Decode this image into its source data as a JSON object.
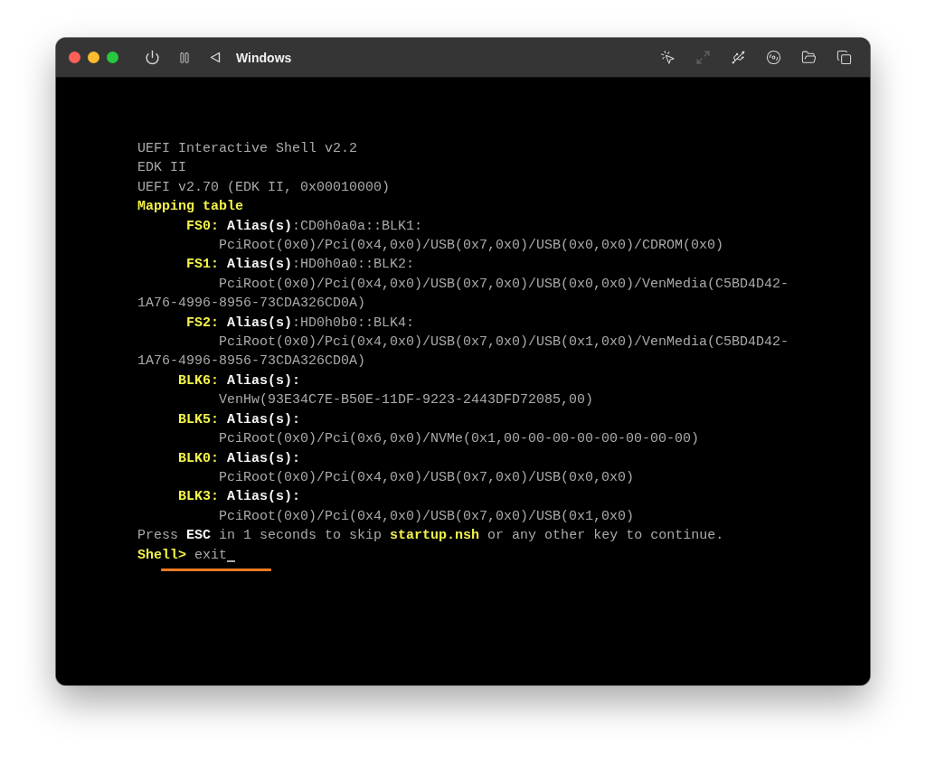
{
  "window": {
    "title": "Windows",
    "toolbar_right": [
      {
        "kind": "pointer",
        "disabled": false
      },
      {
        "kind": "resize",
        "disabled": true
      },
      {
        "kind": "usb",
        "disabled": false
      },
      {
        "kind": "disc",
        "disabled": false
      },
      {
        "kind": "folder",
        "disabled": false
      },
      {
        "kind": "windows",
        "disabled": false
      }
    ]
  },
  "terminal": {
    "lines": [
      {
        "kind": "plain",
        "segments": [
          {
            "color": "#a9a9a9",
            "bold": false,
            "text": "UEFI Interactive Shell v2.2"
          }
        ]
      },
      {
        "kind": "plain",
        "segments": [
          {
            "color": "#a9a9a9",
            "bold": false,
            "text": "EDK II"
          }
        ]
      },
      {
        "kind": "plain",
        "segments": [
          {
            "color": "#a9a9a9",
            "bold": false,
            "text": "UEFI v2.70 (EDK II, 0x00010000)"
          }
        ]
      },
      {
        "kind": "plain",
        "segments": [
          {
            "color": "#f2f24a",
            "bold": true,
            "text": "Mapping table"
          }
        ]
      },
      {
        "kind": "fs",
        "segments": [
          {
            "color": "#f2f24a",
            "bold": true,
            "text": "FS0:"
          },
          {
            "color": "#f4f4f4",
            "bold": true,
            "text": " Alias(s)"
          },
          {
            "color": "#a9a9a9",
            "bold": false,
            "text": ":CD0h0a0a::BLK1:"
          }
        ]
      },
      {
        "kind": "path",
        "segments": [
          {
            "color": "#a9a9a9",
            "bold": false,
            "text": "PciRoot(0x0)/Pci(0x4,0x0)/USB(0x7,0x0)/USB(0x0,0x0)/CDROM(0x0)"
          }
        ]
      },
      {
        "kind": "fs",
        "segments": [
          {
            "color": "#f2f24a",
            "bold": true,
            "text": "FS1:"
          },
          {
            "color": "#f4f4f4",
            "bold": true,
            "text": " Alias(s)"
          },
          {
            "color": "#a9a9a9",
            "bold": false,
            "text": ":HD0h0a0::BLK2:"
          }
        ]
      },
      {
        "kind": "path",
        "segments": [
          {
            "color": "#a9a9a9",
            "bold": false,
            "text": "PciRoot(0x0)/Pci(0x4,0x0)/USB(0x7,0x0)/USB(0x0,0x0)/VenMedia(C5BD4D42-"
          }
        ]
      },
      {
        "kind": "plain",
        "segments": [
          {
            "color": "#a9a9a9",
            "bold": false,
            "text": "1A76-4996-8956-73CDA326CD0A)"
          }
        ]
      },
      {
        "kind": "fs",
        "segments": [
          {
            "color": "#f2f24a",
            "bold": true,
            "text": "FS2:"
          },
          {
            "color": "#f4f4f4",
            "bold": true,
            "text": " Alias(s)"
          },
          {
            "color": "#a9a9a9",
            "bold": false,
            "text": ":HD0h0b0::BLK4:"
          }
        ]
      },
      {
        "kind": "path",
        "segments": [
          {
            "color": "#a9a9a9",
            "bold": false,
            "text": "PciRoot(0x0)/Pci(0x4,0x0)/USB(0x7,0x0)/USB(0x1,0x0)/VenMedia(C5BD4D42-"
          }
        ]
      },
      {
        "kind": "plain",
        "segments": [
          {
            "color": "#a9a9a9",
            "bold": false,
            "text": "1A76-4996-8956-73CDA326CD0A)"
          }
        ]
      },
      {
        "kind": "blk",
        "segments": [
          {
            "color": "#f2f24a",
            "bold": true,
            "text": "BLK6:"
          },
          {
            "color": "#f4f4f4",
            "bold": true,
            "text": " Alias(s):"
          }
        ]
      },
      {
        "kind": "path",
        "segments": [
          {
            "color": "#a9a9a9",
            "bold": false,
            "text": "VenHw(93E34C7E-B50E-11DF-9223-2443DFD72085,00)"
          }
        ]
      },
      {
        "kind": "blk",
        "segments": [
          {
            "color": "#f2f24a",
            "bold": true,
            "text": "BLK5:"
          },
          {
            "color": "#f4f4f4",
            "bold": true,
            "text": " Alias(s):"
          }
        ]
      },
      {
        "kind": "path",
        "segments": [
          {
            "color": "#a9a9a9",
            "bold": false,
            "text": "PciRoot(0x0)/Pci(0x6,0x0)/NVMe(0x1,00-00-00-00-00-00-00-00)"
          }
        ]
      },
      {
        "kind": "blk",
        "segments": [
          {
            "color": "#f2f24a",
            "bold": true,
            "text": "BLK0:"
          },
          {
            "color": "#f4f4f4",
            "bold": true,
            "text": " Alias(s):"
          }
        ]
      },
      {
        "kind": "path",
        "segments": [
          {
            "color": "#a9a9a9",
            "bold": false,
            "text": "PciRoot(0x0)/Pci(0x4,0x0)/USB(0x7,0x0)/USB(0x0,0x0)"
          }
        ]
      },
      {
        "kind": "blk",
        "segments": [
          {
            "color": "#f2f24a",
            "bold": true,
            "text": "BLK3:"
          },
          {
            "color": "#f4f4f4",
            "bold": true,
            "text": " Alias(s):"
          }
        ]
      },
      {
        "kind": "path",
        "segments": [
          {
            "color": "#a9a9a9",
            "bold": false,
            "text": "PciRoot(0x0)/Pci(0x4,0x0)/USB(0x7,0x0)/USB(0x1,0x0)"
          }
        ]
      },
      {
        "kind": "plain",
        "segments": [
          {
            "color": "#a9a9a9",
            "bold": false,
            "text": "Press "
          },
          {
            "color": "#f4f4f4",
            "bold": true,
            "text": "ESC"
          },
          {
            "color": "#a9a9a9",
            "bold": false,
            "text": " in 1 seconds to skip "
          },
          {
            "color": "#f2f24a",
            "bold": true,
            "text": "startup.nsh"
          },
          {
            "color": "#a9a9a9",
            "bold": false,
            "text": " or any other key to continue."
          }
        ]
      },
      {
        "kind": "prompt",
        "underlined": true,
        "cursor": true,
        "segments": [
          {
            "color": "#f2f24a",
            "bold": true,
            "text": "Shell>"
          },
          {
            "color": "#a9a9a9",
            "bold": false,
            "text": " exit"
          }
        ]
      }
    ]
  }
}
